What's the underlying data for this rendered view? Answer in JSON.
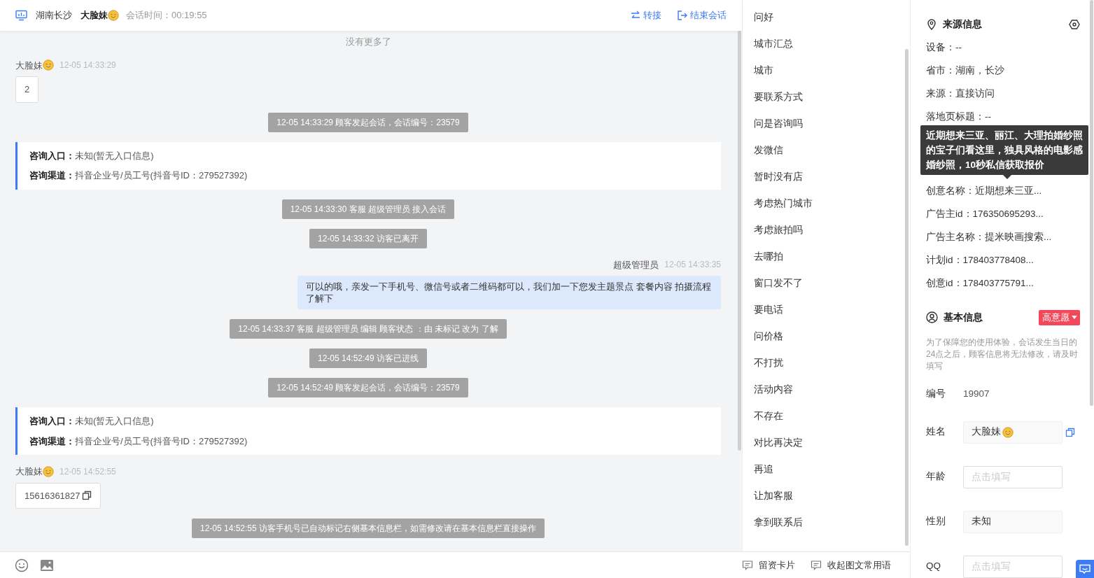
{
  "header": {
    "location": "湖南长沙",
    "visitor_name": "大脸妹",
    "visitor_emoji": true,
    "session_time": "会话时间：00:19:55",
    "actions": [
      {
        "label": "转接"
      },
      {
        "label": "结束会话"
      }
    ]
  },
  "messages": [
    {
      "kind": "notice",
      "text": "没有更多了"
    },
    {
      "kind": "visitor",
      "name": "大脸妹",
      "emoji": true,
      "time": "12-05 14:33:29",
      "text": "2",
      "copy": false
    },
    {
      "kind": "system",
      "text": "12-05 14:33:29 顾客发起会话，会话编号：23579"
    },
    {
      "kind": "info",
      "lines": [
        {
          "label": "咨询入口：",
          "value": "未知(暂无入口信息)"
        },
        {
          "label": "咨询渠道：",
          "value": "抖音企业号/员工号(抖音号ID：279527392)"
        }
      ]
    },
    {
      "kind": "system",
      "text": "12-05 14:33:30 客服 超级管理员 接入会话"
    },
    {
      "kind": "system",
      "text": "12-05 14:33:32 访客已离开"
    },
    {
      "kind": "agent",
      "name": "超级管理员",
      "time": "12-05 14:33:35",
      "text": "可以的哦，亲发一下手机号、微信号或者二维码都可以，我们加一下您发主题景点 套餐内容 拍摄流程了解下"
    },
    {
      "kind": "system",
      "text": "12-05 14:33:37 客服 超级管理员 编辑 顾客状态 ：由 未标记 改为 了解"
    },
    {
      "kind": "system",
      "text": "12-05 14:52:49 访客已进线"
    },
    {
      "kind": "system",
      "text": "12-05 14:52:49 顾客发起会话，会话编号：23579"
    },
    {
      "kind": "info",
      "lines": [
        {
          "label": "咨询入口：",
          "value": "未知(暂无入口信息)"
        },
        {
          "label": "咨询渠道：",
          "value": "抖音企业号/员工号(抖音号ID：279527392)"
        }
      ]
    },
    {
      "kind": "visitor",
      "name": "大脸妹",
      "emoji": true,
      "time": "12-05 14:52:55",
      "text": "15616361827",
      "copy": true
    },
    {
      "kind": "system",
      "text": "12-05 14:52:55 访客手机号已自动标记右侧基本信息栏，如需修改请在基本信息栏直接操作"
    }
  ],
  "phrases": [
    "问好",
    "城市汇总",
    "城市",
    "要联系方式",
    "问是咨询吗",
    "发微信",
    "暂时没有店",
    "考虑热门城市",
    "考虑旅拍吗",
    "去哪拍",
    "窗口发不了",
    "要电话",
    "问价格",
    "不打扰",
    "活动内容",
    "不存在",
    "对比再决定",
    "再追",
    "让加客服",
    "拿到联系后"
  ],
  "bottom_buttons": [
    "留资卡片",
    "收起图文常用语"
  ],
  "source_info": {
    "title": "来源信息",
    "fields": [
      {
        "text": "设备：--"
      },
      {
        "text": "省市：湖南，长沙"
      },
      {
        "text": "来源：直接访问"
      },
      {
        "text": "落地页标题：--"
      },
      {
        "text": "创意名称：近期想来三亚...",
        "tooltip": "近期想来三亚、丽江、大理拍婚纱照的宝子们看这里，独具风格的电影感婚纱照，10秒私信获取报价"
      },
      {
        "text": "广告主id：176350695293..."
      },
      {
        "text": "广告主名称：提米映画搜索..."
      },
      {
        "text": "计划id：178403778408..."
      },
      {
        "text": "创意id：178403775791..."
      }
    ]
  },
  "basic_info": {
    "title": "基本信息",
    "tag": "高意愿",
    "note": "为了保障您的使用体验，会话发生当日的24点之后，顾客信息将无法修改，请及时填写",
    "fields": [
      {
        "kind": "text",
        "label": "编号",
        "value": "19907"
      },
      {
        "kind": "readonly",
        "label": "姓名",
        "value": "大脸妹",
        "emoji": true,
        "copy": true
      },
      {
        "kind": "input",
        "label": "年龄",
        "placeholder": "点击填写"
      },
      {
        "kind": "readonly",
        "label": "性别",
        "value": "未知",
        "emoji": false,
        "copy": false
      },
      {
        "kind": "input",
        "label": "QQ",
        "placeholder": "点击填写"
      }
    ]
  }
}
